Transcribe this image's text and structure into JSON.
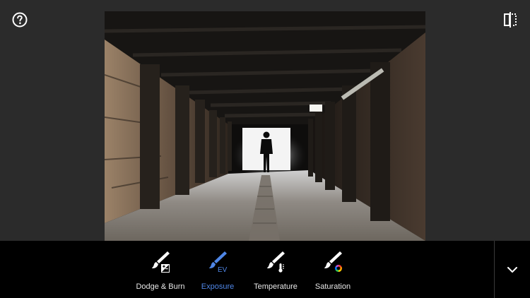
{
  "header": {
    "help_icon": "help-circle-icon",
    "compare_icon": "compare-split-icon"
  },
  "photo": {
    "subject": "tunnel-photo"
  },
  "tools": [
    {
      "label": "Dodge & Burn",
      "icon": "brush-dodge-burn-icon",
      "active": false
    },
    {
      "label": "Exposure",
      "icon": "brush-exposure-icon",
      "active": true,
      "badge": "EV"
    },
    {
      "label": "Temperature",
      "icon": "brush-temperature-icon",
      "active": false
    },
    {
      "label": "Saturation",
      "icon": "brush-saturation-icon",
      "active": false
    }
  ],
  "collapse": {
    "icon": "chevron-down-icon"
  },
  "colors": {
    "accent": "#4f86e6",
    "toolbar_bg": "#000000",
    "app_bg": "#2b2b2b",
    "label_text": "#e8e8e8"
  }
}
